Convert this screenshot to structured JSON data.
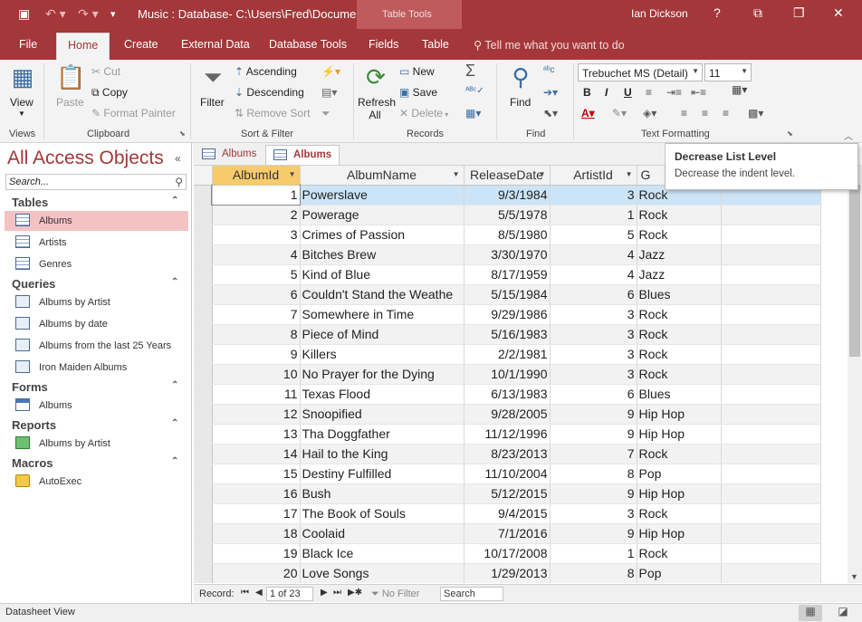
{
  "window": {
    "title": "Music : Database- C:\\Users\\Fred\\Docume...",
    "context_tab": "Table Tools",
    "user": "Ian Dickson",
    "help": "?"
  },
  "ribbon_tabs": [
    "File",
    "Home",
    "Create",
    "External Data",
    "Database Tools",
    "Fields",
    "Table"
  ],
  "active_tab": "Home",
  "tell_me": "Tell me what you want to do",
  "ribbon": {
    "views": {
      "view_label": "View",
      "group": "Views"
    },
    "clipboard": {
      "paste": "Paste",
      "cut": "Cut",
      "copy": "Copy",
      "format_painter": "Format Painter",
      "group": "Clipboard"
    },
    "sort_filter": {
      "filter": "Filter",
      "ascending": "Ascending",
      "descending": "Descending",
      "remove_sort": "Remove Sort",
      "group": "Sort & Filter"
    },
    "records": {
      "refresh_all": "Refresh All",
      "new": "New",
      "save": "Save",
      "delete": "Delete",
      "group": "Records"
    },
    "find": {
      "find": "Find",
      "group": "Find"
    },
    "text_formatting": {
      "font": "Trebuchet MS (Detail)",
      "size": "11",
      "group": "Text Formatting"
    }
  },
  "tooltip": {
    "title": "Decrease List Level",
    "description": "Decrease the indent level."
  },
  "nav": {
    "title": "All Access Objects",
    "search_placeholder": "Search...",
    "sections": [
      {
        "name": "Tables",
        "items": [
          "Albums",
          "Artists",
          "Genres"
        ]
      },
      {
        "name": "Queries",
        "items": [
          "Albums by Artist",
          "Albums by date",
          "Albums from the last 25 Years",
          "Iron Maiden Albums"
        ]
      },
      {
        "name": "Forms",
        "items": [
          "Albums"
        ]
      },
      {
        "name": "Reports",
        "items": [
          "Albums by Artist"
        ]
      },
      {
        "name": "Macros",
        "items": [
          "AutoExec"
        ]
      }
    ],
    "selected_item": "Albums"
  },
  "doc_tabs": [
    {
      "label": "Albums",
      "active": false
    },
    {
      "label": "Albums",
      "active": true
    }
  ],
  "table": {
    "columns": [
      "AlbumId",
      "AlbumName",
      "ReleaseDate",
      "ArtistId",
      "G"
    ],
    "rows": [
      [
        "1",
        "Powerslave",
        "9/3/1984",
        "3",
        "Rock"
      ],
      [
        "2",
        "Powerage",
        "5/5/1978",
        "1",
        "Rock"
      ],
      [
        "3",
        "Crimes of Passion",
        "8/5/1980",
        "5",
        "Rock"
      ],
      [
        "4",
        "Bitches Brew",
        "3/30/1970",
        "4",
        "Jazz"
      ],
      [
        "5",
        "Kind of Blue",
        "8/17/1959",
        "4",
        "Jazz"
      ],
      [
        "6",
        "Couldn't Stand the Weathe",
        "5/15/1984",
        "6",
        "Blues"
      ],
      [
        "7",
        "Somewhere in Time",
        "9/29/1986",
        "3",
        "Rock"
      ],
      [
        "8",
        "Piece of Mind",
        "5/16/1983",
        "3",
        "Rock"
      ],
      [
        "9",
        "Killers",
        "2/2/1981",
        "3",
        "Rock"
      ],
      [
        "10",
        "No Prayer for the Dying",
        "10/1/1990",
        "3",
        "Rock"
      ],
      [
        "11",
        "Texas Flood",
        "6/13/1983",
        "6",
        "Blues"
      ],
      [
        "12",
        "Snoopified",
        "9/28/2005",
        "9",
        "Hip Hop"
      ],
      [
        "13",
        "Tha Doggfather",
        "11/12/1996",
        "9",
        "Hip Hop"
      ],
      [
        "14",
        "Hail to the King",
        "8/23/2013",
        "7",
        "Rock"
      ],
      [
        "15",
        "Destiny Fulfilled",
        "11/10/2004",
        "8",
        "Pop"
      ],
      [
        "16",
        "Bush",
        "5/12/2015",
        "9",
        "Hip Hop"
      ],
      [
        "17",
        "The Book of Souls",
        "9/4/2015",
        "3",
        "Rock"
      ],
      [
        "18",
        "Coolaid",
        "7/1/2016",
        "9",
        "Hip Hop"
      ],
      [
        "19",
        "Black Ice",
        "10/17/2008",
        "1",
        "Rock"
      ],
      [
        "20",
        "Love Songs",
        "1/29/2013",
        "8",
        "Pop"
      ]
    ]
  },
  "record_nav": {
    "label": "Record:",
    "current": "1 of 23",
    "no_filter": "No Filter",
    "search": "Search"
  },
  "status": {
    "text": "Datasheet View"
  },
  "colors": {
    "accent": "#a4373a",
    "selected_row": "#cce4f7",
    "sorted_header": "#f7cb6b",
    "nav_selected": "#f5c2c4"
  }
}
